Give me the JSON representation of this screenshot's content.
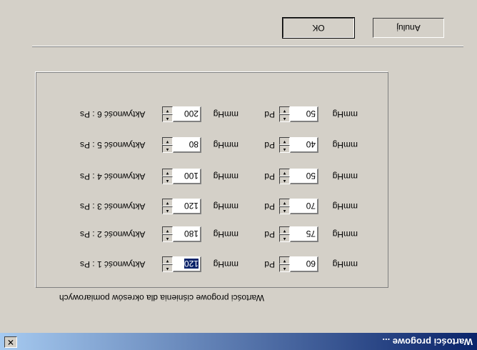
{
  "window": {
    "title": "Wartości progowe ...",
    "close_glyph": "✕"
  },
  "group_caption": "Wartości progowe ciśnienia dla okresów pomiarowych",
  "rows": [
    {
      "label": "Aktywność 1 : Ps",
      "ps": "120",
      "ps_unit": "mmHg",
      "pd_label": "Pd",
      "pd": "60",
      "pd_unit": "mmHg"
    },
    {
      "label": "Aktywność 2 : Ps",
      "ps": "180",
      "ps_unit": "mmHg",
      "pd_label": "Pd",
      "pd": "75",
      "pd_unit": "mmHg"
    },
    {
      "label": "Aktywność 3 : Ps",
      "ps": "120",
      "ps_unit": "mmHg",
      "pd_label": "Pd",
      "pd": "70",
      "pd_unit": "mmHg"
    },
    {
      "label": "Aktywność 4 : Ps",
      "ps": "100",
      "ps_unit": "mmHg",
      "pd_label": "Pd",
      "pd": "50",
      "pd_unit": "mmHg"
    },
    {
      "label": "Aktywność 5 : Ps",
      "ps": "80",
      "ps_unit": "mmHg",
      "pd_label": "Pd",
      "pd": "40",
      "pd_unit": "mmHg"
    },
    {
      "label": "Aktywność 6 : Ps",
      "ps": "200",
      "ps_unit": "mmHg",
      "pd_label": "Pd",
      "pd": "50",
      "pd_unit": "mmHg"
    }
  ],
  "buttons": {
    "ok": "OK",
    "cancel": "Anuluj"
  },
  "icons": {
    "spin_up": "▲",
    "spin_down": "▼"
  },
  "colors": {
    "titlebar_start": "#0a246a",
    "titlebar_end": "#a6caf0",
    "face": "#d4d0c8"
  }
}
